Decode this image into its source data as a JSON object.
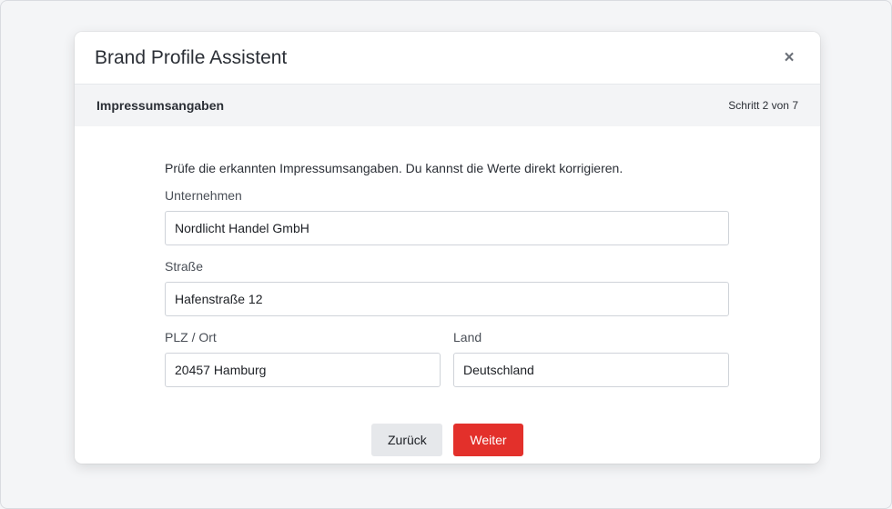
{
  "dialog": {
    "title": "Brand Profile Assistent",
    "close_label": "×"
  },
  "step": {
    "title": "Impressumsangaben",
    "counter": "Schritt 2 von 7"
  },
  "form": {
    "intro": "Prüfe die erkannten Impressumsangaben. Du kannst die Werte direkt korrigieren.",
    "company": {
      "label": "Unternehmen",
      "value": "Nordlicht Handel GmbH"
    },
    "street": {
      "label": "Straße",
      "value": "Hafenstraße 12"
    },
    "zip_city": {
      "label": "PLZ / Ort",
      "value": "20457 Hamburg"
    },
    "country": {
      "label": "Land",
      "value": "Deutschland"
    }
  },
  "actions": {
    "back_label": "Zurück",
    "next_label": "Weiter"
  },
  "colors": {
    "accent": "#e3302b",
    "secondary_button": "#e6e8eb",
    "step_bar_bg": "#f3f4f6"
  }
}
